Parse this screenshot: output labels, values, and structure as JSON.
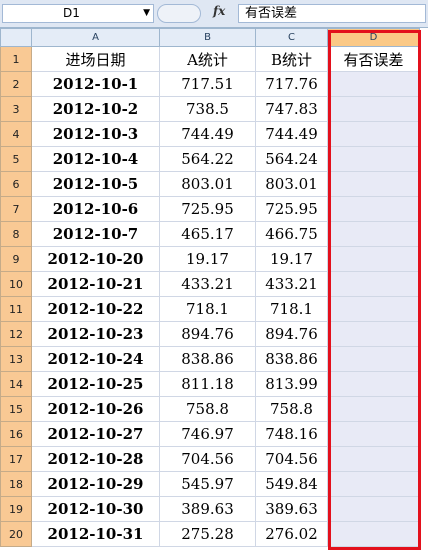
{
  "formula_bar": {
    "name_box": "D1",
    "fx_label": "fx",
    "content": "有否误差"
  },
  "columns": [
    "A",
    "B",
    "C",
    "D"
  ],
  "header_row": {
    "row_number": "1",
    "cells": [
      "进场日期",
      "A统计",
      "B统计",
      "有否误差"
    ]
  },
  "rows": [
    {
      "n": "2",
      "a": "2012-10-1",
      "b": "717.51",
      "c": "717.76",
      "d": ""
    },
    {
      "n": "3",
      "a": "2012-10-2",
      "b": "738.5",
      "c": "747.83",
      "d": ""
    },
    {
      "n": "4",
      "a": "2012-10-3",
      "b": "744.49",
      "c": "744.49",
      "d": ""
    },
    {
      "n": "5",
      "a": "2012-10-4",
      "b": "564.22",
      "c": "564.24",
      "d": ""
    },
    {
      "n": "6",
      "a": "2012-10-5",
      "b": "803.01",
      "c": "803.01",
      "d": ""
    },
    {
      "n": "7",
      "a": "2012-10-6",
      "b": "725.95",
      "c": "725.95",
      "d": ""
    },
    {
      "n": "8",
      "a": "2012-10-7",
      "b": "465.17",
      "c": "466.75",
      "d": ""
    },
    {
      "n": "9",
      "a": "2012-10-20",
      "b": "19.17",
      "c": "19.17",
      "d": ""
    },
    {
      "n": "10",
      "a": "2012-10-21",
      "b": "433.21",
      "c": "433.21",
      "d": ""
    },
    {
      "n": "11",
      "a": "2012-10-22",
      "b": "718.1",
      "c": "718.1",
      "d": ""
    },
    {
      "n": "12",
      "a": "2012-10-23",
      "b": "894.76",
      "c": "894.76",
      "d": ""
    },
    {
      "n": "13",
      "a": "2012-10-24",
      "b": "838.86",
      "c": "838.86",
      "d": ""
    },
    {
      "n": "14",
      "a": "2012-10-25",
      "b": "811.18",
      "c": "813.99",
      "d": ""
    },
    {
      "n": "15",
      "a": "2012-10-26",
      "b": "758.8",
      "c": "758.8",
      "d": ""
    },
    {
      "n": "16",
      "a": "2012-10-27",
      "b": "746.97",
      "c": "748.16",
      "d": ""
    },
    {
      "n": "17",
      "a": "2012-10-28",
      "b": "704.56",
      "c": "704.56",
      "d": ""
    },
    {
      "n": "18",
      "a": "2012-10-29",
      "b": "545.97",
      "c": "549.84",
      "d": ""
    },
    {
      "n": "19",
      "a": "2012-10-30",
      "b": "389.63",
      "c": "389.63",
      "d": ""
    },
    {
      "n": "20",
      "a": "2012-10-31",
      "b": "275.28",
      "c": "276.02",
      "d": ""
    }
  ],
  "colors": {
    "selection_outline": "#e3101c",
    "row_header": "#f9c994",
    "selected_column_header": "#fbc986",
    "selected_column_fill": "#e8eaf6"
  }
}
